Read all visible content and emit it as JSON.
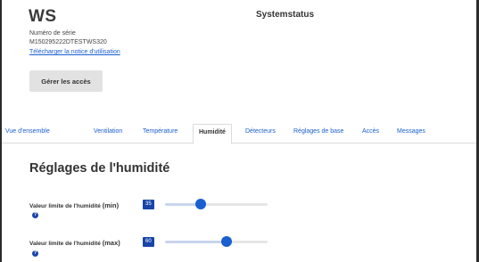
{
  "device": {
    "title": "WS",
    "system_status": "Systemstatus",
    "serial_label": "Numéro de série",
    "serial_value": "M150295222DTESTWS320",
    "manual_link": "Télécharger la notice d'utilisation",
    "access_button": "Gérer les accès"
  },
  "tabs": [
    {
      "label": "Vue d'ensemble"
    },
    {
      "label": "Ventilation"
    },
    {
      "label": "Température"
    },
    {
      "label": "Humidité",
      "active": true
    },
    {
      "label": "Détecteurs"
    },
    {
      "label": "Réglages de base"
    },
    {
      "label": "Accès"
    },
    {
      "label": "Messages"
    }
  ],
  "humidity": {
    "title": "Réglages de l'humidité",
    "sliders": [
      {
        "label": "Valeur limite de l'humidité",
        "qualifier": "(min)",
        "value": "35",
        "level": 0.35
      },
      {
        "label": "Valeur limite de l'humidité",
        "qualifier": "(max)",
        "value": "60",
        "level": 0.6
      }
    ],
    "help_glyph": "?"
  },
  "colors": {
    "accent": "#1a5fd0",
    "badge": "#1746a8",
    "button_bg": "#e2e2e2"
  }
}
